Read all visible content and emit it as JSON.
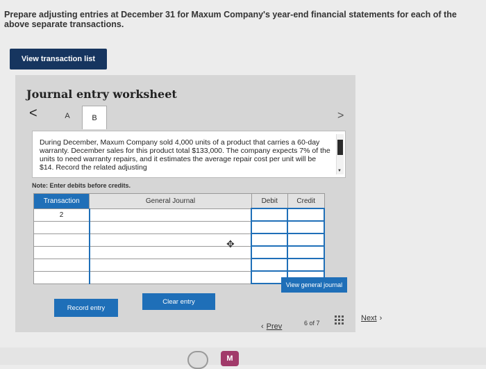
{
  "instructions": {
    "text_bold": "Prepare adjusting entries at December 31 for Maxum Company's year-end financial statements for each of the above separate transactions."
  },
  "view_transaction_list": {
    "label": "View transaction list"
  },
  "worksheet": {
    "title": "Journal entry worksheet",
    "nav_prev": "<",
    "nav_next": ">",
    "tabs": [
      {
        "label": "A"
      },
      {
        "label": "B"
      }
    ],
    "description": "During December, Maxum Company sold 4,000 units of a product that carries a 60-day warranty. December sales for this product total $133,000. The company expects 7% of the units to need warranty repairs, and it estimates the average repair cost per unit will be $14. Record the related adjusting",
    "note": "Note: Enter debits before credits."
  },
  "journal_table": {
    "headers": [
      "Transaction",
      "General Journal",
      "Debit",
      "Credit"
    ],
    "rows": [
      {
        "transaction": "2",
        "general_journal": "",
        "debit": "",
        "credit": ""
      },
      {
        "transaction": "",
        "general_journal": "",
        "debit": "",
        "credit": ""
      },
      {
        "transaction": "",
        "general_journal": "",
        "debit": "",
        "credit": ""
      },
      {
        "transaction": "",
        "general_journal": "",
        "debit": "",
        "credit": ""
      },
      {
        "transaction": "",
        "general_journal": "",
        "debit": "",
        "credit": ""
      },
      {
        "transaction": "",
        "general_journal": "",
        "debit": "",
        "credit": ""
      }
    ]
  },
  "buttons": {
    "record_entry": "Record entry",
    "clear_entry": "Clear entry",
    "view_general_journal": "View general journal"
  },
  "pager": {
    "prev_label": "Prev",
    "page_text": "6 of 7",
    "next_label": "Next"
  },
  "dock": {
    "icon_b_letter": "M"
  },
  "colors": {
    "dark_navy": "#16355f",
    "accent_blue": "#1f6fb8"
  }
}
